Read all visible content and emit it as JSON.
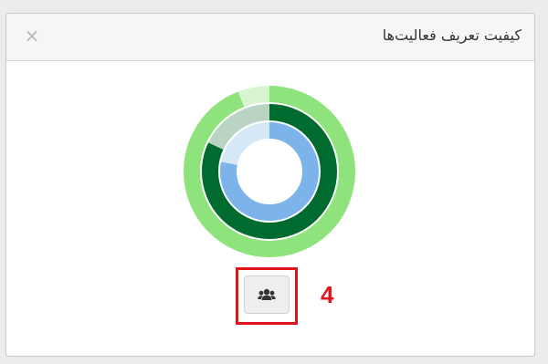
{
  "dialog": {
    "title": "کیفیت تعریف فعالیت‌ها",
    "close_label": "×"
  },
  "rings": {
    "outer": {
      "color": "#8ee37c",
      "track_color": "#d6f5d0",
      "value": 0.94
    },
    "middle": {
      "color": "#006b2e",
      "track_color": "#b9d4c3",
      "value": 0.82
    },
    "inner": {
      "color": "#7cb3ea",
      "track_color": "#d5e8f8",
      "value": 0.78
    }
  },
  "toolbar": {
    "members_icon": "users-icon"
  },
  "annotation": {
    "step_number": "4",
    "color": "#e0151b"
  }
}
